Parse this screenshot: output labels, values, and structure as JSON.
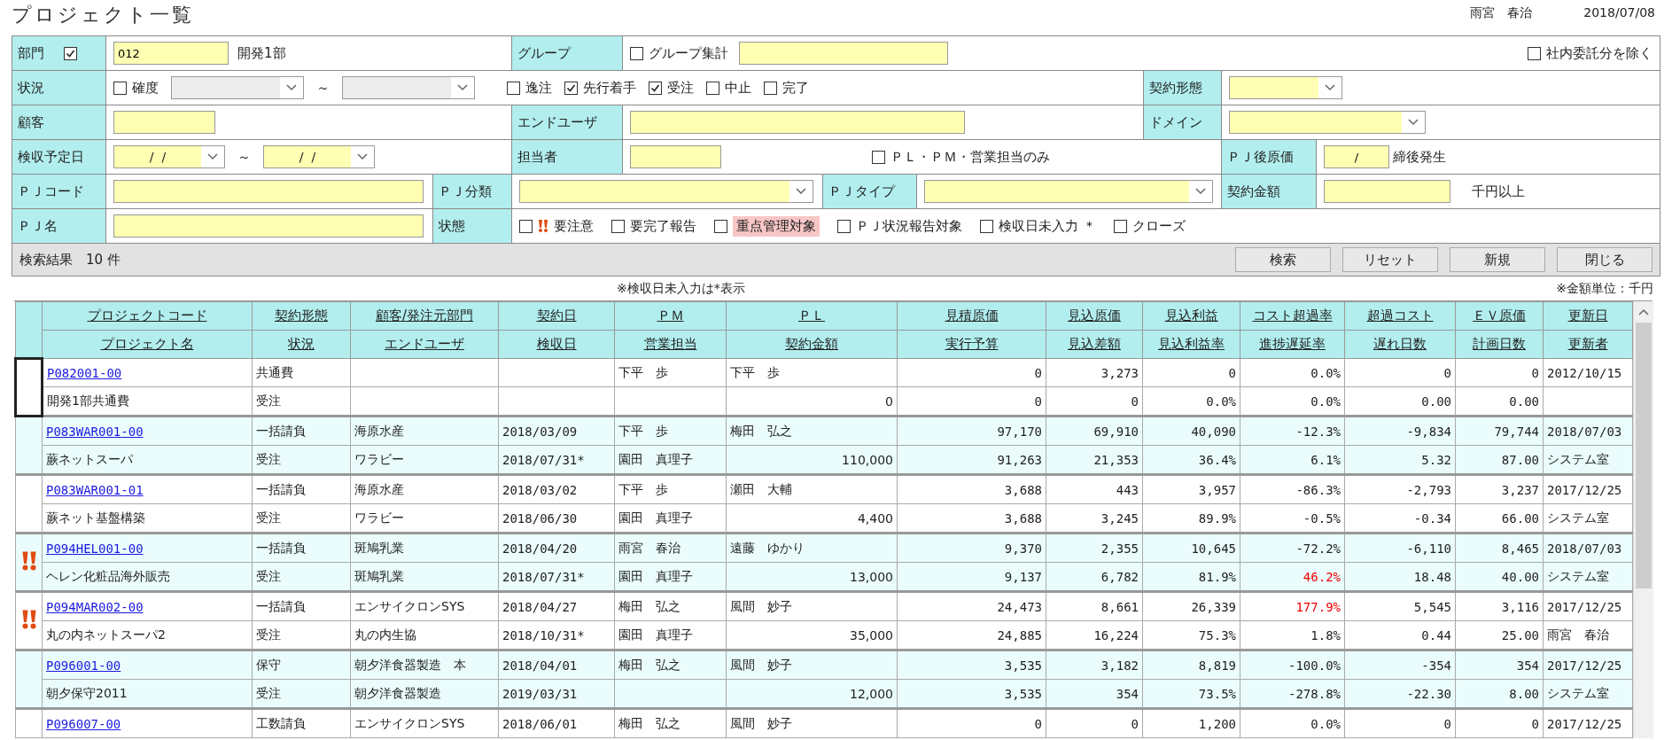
{
  "title": "プロジェクト一覧",
  "user": "雨宮　春治",
  "date": "2018/07/08",
  "filters": {
    "department": {
      "label": "部門",
      "checked": true,
      "code": "012",
      "name": "開発1部"
    },
    "group": {
      "label": "グループ",
      "aggregate": {
        "label": "グループ集計",
        "checked": false
      }
    },
    "exclude_internal": {
      "label": "社内委託分を除く",
      "checked": false
    },
    "status": {
      "label": "状況",
      "certainty": {
        "label": "確度",
        "checked": false,
        "range_disabled": true
      },
      "range_sep": "～",
      "options": [
        {
          "label": "逸注",
          "checked": false
        },
        {
          "label": "先行着手",
          "checked": true
        },
        {
          "label": "受注",
          "checked": true
        },
        {
          "label": "中止",
          "checked": false
        },
        {
          "label": "完了",
          "checked": false
        }
      ]
    },
    "contract_type": {
      "label": "契約形態"
    },
    "customer": {
      "label": "顧客"
    },
    "end_user": {
      "label": "エンドユーザ"
    },
    "domain": {
      "label": "ドメイン"
    },
    "acceptance_date": {
      "label": "検収予定日",
      "from": "/  /",
      "to": "/  /",
      "range_sep": "～"
    },
    "person": {
      "label": "担当者",
      "only_mine": {
        "label": "ＰＬ・ＰＭ・営業担当のみ",
        "checked": false
      }
    },
    "post_cost": {
      "label": "ＰＪ後原価",
      "value": "/",
      "suffix": "締後発生"
    },
    "pj_code": {
      "label": "ＰＪコード"
    },
    "pj_category": {
      "label": "ＰＪ分類"
    },
    "pj_type": {
      "label": "ＰＪタイプ"
    },
    "contract_amount": {
      "label": "契約金額",
      "suffix": "千円以上"
    },
    "pj_name": {
      "label": "ＰＪ名"
    },
    "state": {
      "label": "状態",
      "options": [
        {
          "label": "要注意",
          "checked": false,
          "kind": "attention"
        },
        {
          "label": "要完了報告",
          "checked": false,
          "kind": "plain"
        },
        {
          "label": "重点管理対象",
          "checked": false,
          "kind": "highlight"
        },
        {
          "label": "ＰＪ状況報告対象",
          "checked": false,
          "kind": "plain"
        },
        {
          "label": "検収日未入力 ＊",
          "checked": false,
          "kind": "plain"
        },
        {
          "label": "クローズ",
          "checked": false,
          "kind": "plain"
        }
      ]
    }
  },
  "result": "検索結果　10 件",
  "buttons": [
    "検索",
    "リセット",
    "新規",
    "閉じる"
  ],
  "notes": {
    "acceptance": "※検収日未入力は*表示",
    "unit": "※金額単位：千円"
  },
  "table": {
    "columns": [
      {
        "top": "プロジェクトコード",
        "bottom": "プロジェクト名"
      },
      {
        "top": "契約形態",
        "bottom": "状況"
      },
      {
        "top": "顧客/発注元部門",
        "bottom": "エンドユーザ"
      },
      {
        "top": "契約日",
        "bottom": "検収日"
      },
      {
        "top": "ＰＭ",
        "bottom": "営業担当"
      },
      {
        "top": "ＰＬ",
        "bottom": "契約金額"
      },
      {
        "top": "見積原価",
        "bottom": "実行予算"
      },
      {
        "top": "見込原価",
        "bottom": "見込差額"
      },
      {
        "top": "見込利益",
        "bottom": "見込利益率"
      },
      {
        "top": "コスト超過率",
        "bottom": "進捗遅延率"
      },
      {
        "top": "超過コスト",
        "bottom": "遅れ日数"
      },
      {
        "top": "ＥＶ原価",
        "bottom": "計画日数"
      },
      {
        "top": "更新日",
        "bottom": "更新者"
      }
    ],
    "rows": [
      {
        "selected": true,
        "attention": false,
        "cost_over_alert": false,
        "delay_alert": false,
        "code": "P082001-00",
        "contract_type": "共通費",
        "pm": "下平　歩",
        "pl": "下平　歩",
        "estimate_cost": "0",
        "expected_cost": "3,273",
        "expected_profit": "0",
        "cost_over_rate": "0.0%",
        "over_cost": "0",
        "ev_cost": "0",
        "updated": "2012/10/15",
        "name": "開発1部共通費",
        "status": "受注",
        "contract_amount": "0",
        "budget": "0",
        "expected_diff": "0",
        "profit_rate": "0.0%",
        "delay_rate": "0.0%",
        "delay_days": "0.00",
        "plan_days": "0.00"
      },
      {
        "selected": false,
        "attention": false,
        "cost_over_alert": false,
        "delay_alert": false,
        "code": "P083WAR001-00",
        "contract_type": "一括請負",
        "customer": "海原水産",
        "contract_date": "2018/03/09",
        "pm": "下平　歩",
        "pl": "梅田　弘之",
        "estimate_cost": "97,170",
        "expected_cost": "69,910",
        "expected_profit": "40,090",
        "cost_over_rate": "-12.3%",
        "over_cost": "-9,834",
        "ev_cost": "79,744",
        "updated": "2018/07/03",
        "name": "蕨ネットスーパ",
        "status": "受注",
        "end_user": "ワラビー",
        "acceptance_date": "2018/07/31*",
        "sales": "園田　真理子",
        "contract_amount": "110,000",
        "budget": "91,263",
        "expected_diff": "21,353",
        "profit_rate": "36.4%",
        "delay_rate": "6.1%",
        "delay_days": "5.32",
        "plan_days": "87.00",
        "updater": "システム室"
      },
      {
        "selected": false,
        "attention": false,
        "cost_over_alert": false,
        "delay_alert": false,
        "code": "P083WAR001-01",
        "contract_type": "一括請負",
        "customer": "海原水産",
        "contract_date": "2018/03/02",
        "pm": "下平　歩",
        "pl": "瀬田　大輔",
        "estimate_cost": "3,688",
        "expected_cost": "443",
        "expected_profit": "3,957",
        "cost_over_rate": "-86.3%",
        "over_cost": "-2,793",
        "ev_cost": "3,237",
        "updated": "2017/12/25",
        "name": "蕨ネット基盤構築",
        "status": "受注",
        "end_user": "ワラビー",
        "acceptance_date": "2018/06/30",
        "sales": "園田　真理子",
        "contract_amount": "4,400",
        "budget": "3,688",
        "expected_diff": "3,245",
        "profit_rate": "89.9%",
        "delay_rate": "-0.5%",
        "delay_days": "-0.34",
        "plan_days": "66.00",
        "updater": "システム室"
      },
      {
        "selected": false,
        "attention": true,
        "cost_over_alert": false,
        "delay_alert": true,
        "code": "P094HEL001-00",
        "contract_type": "一括請負",
        "customer": "斑鳩乳業",
        "contract_date": "2018/04/20",
        "pm": "雨宮　春治",
        "pl": "遠藤　ゆかり",
        "estimate_cost": "9,370",
        "expected_cost": "2,355",
        "expected_profit": "10,645",
        "cost_over_rate": "-72.2%",
        "over_cost": "-6,110",
        "ev_cost": "8,465",
        "updated": "2018/07/03",
        "name": "ヘレン化粧品海外販売",
        "status": "受注",
        "end_user": "斑鳩乳業",
        "acceptance_date": "2018/07/31*",
        "sales": "園田　真理子",
        "contract_amount": "13,000",
        "budget": "9,137",
        "expected_diff": "6,782",
        "profit_rate": "81.9%",
        "delay_rate": "46.2%",
        "delay_days": "18.48",
        "plan_days": "40.00",
        "updater": "システム室"
      },
      {
        "selected": false,
        "attention": true,
        "cost_over_alert": true,
        "delay_alert": false,
        "code": "P094MAR002-00",
        "contract_type": "一括請負",
        "customer": "エンサイクロンSYS",
        "contract_date": "2018/04/27",
        "pm": "梅田　弘之",
        "pl": "風間　妙子",
        "estimate_cost": "24,473",
        "expected_cost": "8,661",
        "expected_profit": "26,339",
        "cost_over_rate": "177.9%",
        "over_cost": "5,545",
        "ev_cost": "3,116",
        "updated": "2017/12/25",
        "name": "丸の内ネットスーパ2",
        "status": "受注",
        "end_user": "丸の内生協",
        "acceptance_date": "2018/10/31*",
        "sales": "園田　真理子",
        "contract_amount": "35,000",
        "budget": "24,885",
        "expected_diff": "16,224",
        "profit_rate": "75.3%",
        "delay_rate": "1.8%",
        "delay_days": "0.44",
        "plan_days": "25.00",
        "updater": "雨宮　春治"
      },
      {
        "selected": false,
        "attention": false,
        "cost_over_alert": false,
        "delay_alert": false,
        "code": "P096001-00",
        "contract_type": "保守",
        "customer": "朝夕洋食器製造　本",
        "contract_date": "2018/04/01",
        "pm": "梅田　弘之",
        "pl": "風間　妙子",
        "estimate_cost": "3,535",
        "expected_cost": "3,182",
        "expected_profit": "8,819",
        "cost_over_rate": "-100.0%",
        "over_cost": "-354",
        "ev_cost": "354",
        "updated": "2017/12/25",
        "name": "朝夕保守2011",
        "status": "受注",
        "end_user": "朝夕洋食器製造",
        "acceptance_date": "2019/03/31",
        "contract_amount": "12,000",
        "budget": "3,535",
        "expected_diff": "354",
        "profit_rate": "73.5%",
        "delay_rate": "-278.8%",
        "delay_days": "-22.30",
        "plan_days": "8.00",
        "updater": "システム室"
      },
      {
        "selected": false,
        "attention": false,
        "cost_over_alert": false,
        "code": "P096007-00",
        "contract_type": "工数請負",
        "customer": "エンサイクロンSYS",
        "contract_date": "2018/06/01",
        "pm": "梅田　弘之",
        "pl": "風間　妙子",
        "estimate_cost": "0",
        "expected_cost": "0",
        "expected_profit": "1,200",
        "cost_over_rate": "0.0%",
        "over_cost": "0",
        "ev_cost": "0",
        "updated": "2017/12/25"
      }
    ]
  }
}
